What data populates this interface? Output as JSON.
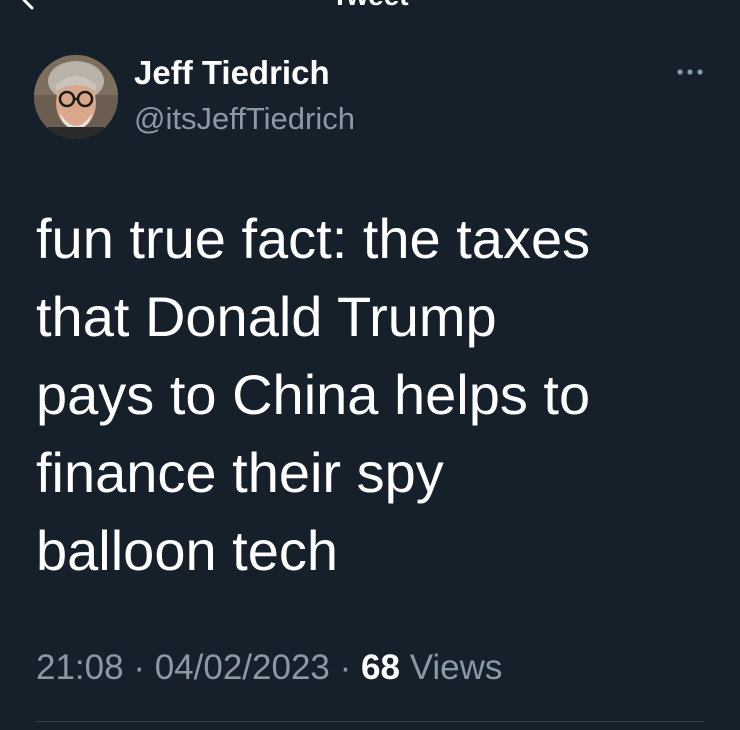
{
  "header": {
    "title": "Tweet"
  },
  "tweet": {
    "author_name": "Jeff Tiedrich",
    "author_handle": "@itsJeffTiedrich",
    "text_lines": [
      "fun true fact: the taxes",
      "that Donald Trump",
      "pays to China helps to",
      "finance their spy",
      "balloon tech"
    ],
    "time": "21:08",
    "date": "04/02/2023",
    "separator": "·",
    "views_count": "68",
    "views_label": "Views"
  },
  "icons": {
    "back": "back-arrow-icon",
    "more": "more-horizontal-icon"
  },
  "colors": {
    "background": "#15202b",
    "primary_text": "#ffffff",
    "secondary_text": "#8b98a5",
    "divider": "#38444d"
  }
}
